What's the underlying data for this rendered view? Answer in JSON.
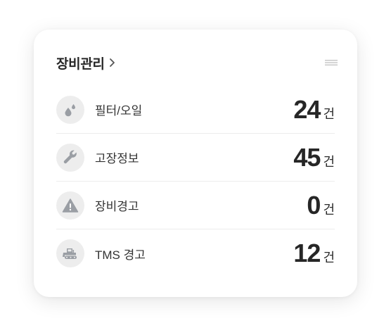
{
  "card": {
    "title": "장비관리",
    "title_chevron_icon": "chevron-right-icon",
    "menu_icon": "hamburger-menu-icon"
  },
  "items": [
    {
      "label": "필터/오일",
      "count": "24",
      "unit": "건",
      "icon": "oil-drop-icon"
    },
    {
      "label": "고장정보",
      "count": "45",
      "unit": "건",
      "icon": "wrench-icon"
    },
    {
      "label": "장비경고",
      "count": "0",
      "unit": "건",
      "icon": "warning-triangle-icon"
    },
    {
      "label": "TMS 경고",
      "count": "12",
      "unit": "건",
      "icon": "bulldozer-icon"
    }
  ],
  "colors": {
    "icon_fill": "#9a9ea4",
    "icon_bg": "#ededed",
    "divider": "#ececec",
    "text_dark": "#262626"
  }
}
